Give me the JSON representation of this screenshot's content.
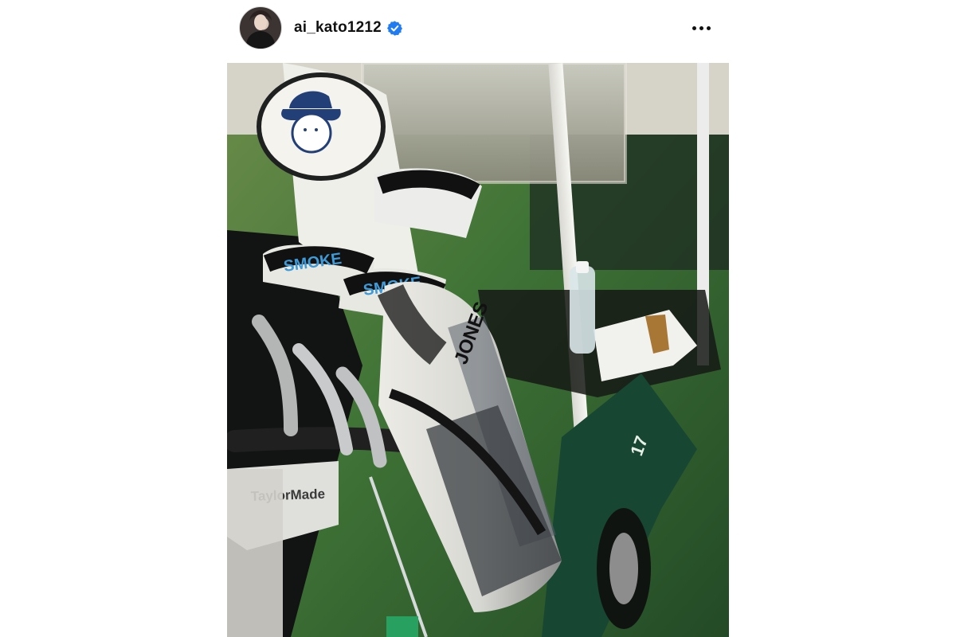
{
  "post": {
    "username": "ai_kato1212",
    "verified": true,
    "more_icon": "more-horizontal-icon",
    "avatar_icon": "profile-avatar",
    "verified_icon": "verified-badge-icon"
  },
  "photo": {
    "subject": "golf bag on cart",
    "colors": {
      "grass": "#2f5e30",
      "cart_green": "#1f4b35",
      "bag_white": "#e7e6df",
      "headcover_navy": "#223f78",
      "accent_blue": "#3f9ad8"
    },
    "visible_text": {
      "bag_brand": "JONES",
      "headcover_text_1": "SMOKE",
      "headcover_text_2": "SMOKE",
      "bag_logo": "TaylorMade",
      "cart_number": "17"
    }
  }
}
